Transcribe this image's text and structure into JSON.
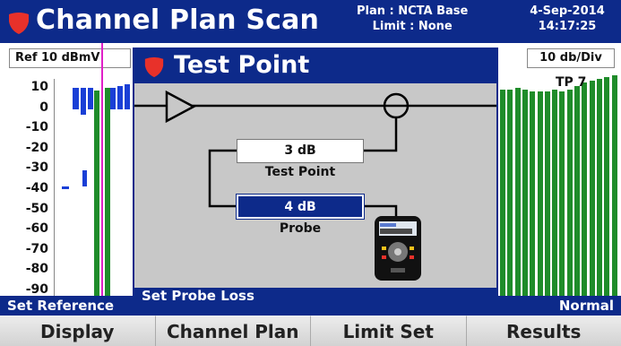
{
  "header": {
    "title": "Channel Plan Scan",
    "plan": "Plan : NCTA Base",
    "limit": "Limit : None",
    "date": "4-Sep-2014",
    "time": "14:17:25",
    "logo_icon": "shield-icon"
  },
  "spectrum": {
    "ref_level": "Ref 10 dBmV",
    "scale": "10 db/Div",
    "y_ticks": [
      "10",
      "0",
      "-10",
      "-20",
      "-30",
      "-40",
      "-50",
      "-60",
      "-70",
      "-80",
      "-90"
    ],
    "marker_label": "TP 7",
    "colors": {
      "bar_green": "#1f8c2a",
      "bar_blue": "#1a3fd6",
      "marker": "#e020c8"
    }
  },
  "status": {
    "left": "Set Reference",
    "right": "Normal"
  },
  "dialog": {
    "title": "Test Point",
    "test_point_value": "3 dB",
    "test_point_label": "Test Point",
    "probe_value": "4 dB",
    "probe_label": "Probe",
    "status": "Set Probe Loss"
  },
  "softkeys": [
    "Display",
    "Channel Plan",
    "Limit Set",
    "Results"
  ],
  "colors": {
    "accent": "#0d2a8a",
    "dialog_bg": "#c8c8c8",
    "logo_red": "#e8312a"
  }
}
